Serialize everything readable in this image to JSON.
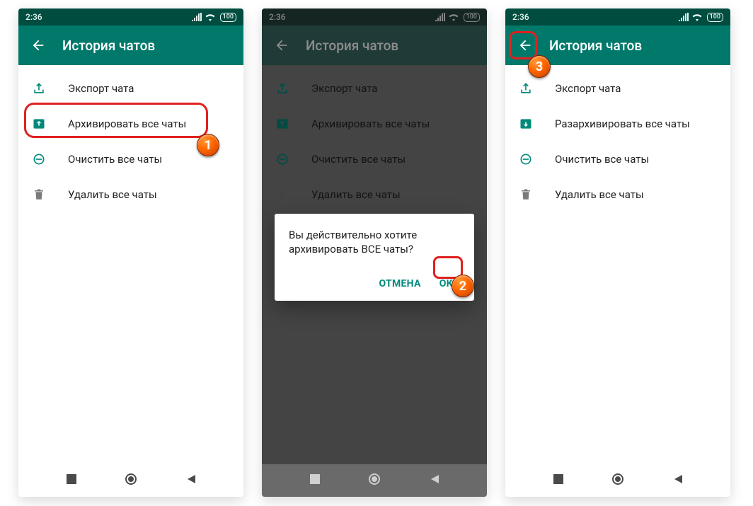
{
  "status": {
    "time": "2:36",
    "battery": "100"
  },
  "appbar_title": "История чатов",
  "menu": {
    "export": "Экспорт чата",
    "archive": "Архивировать все чаты",
    "unarchive": "Разархивировать все чаты",
    "clear": "Очистить все чаты",
    "delete": "Удалить все чаты"
  },
  "dialog": {
    "message": "Вы действительно хотите архивировать ВСЕ чаты?",
    "cancel": "ОТМЕНА",
    "ok": "ОК"
  },
  "steps": {
    "one": "1",
    "two": "2",
    "three": "3"
  }
}
